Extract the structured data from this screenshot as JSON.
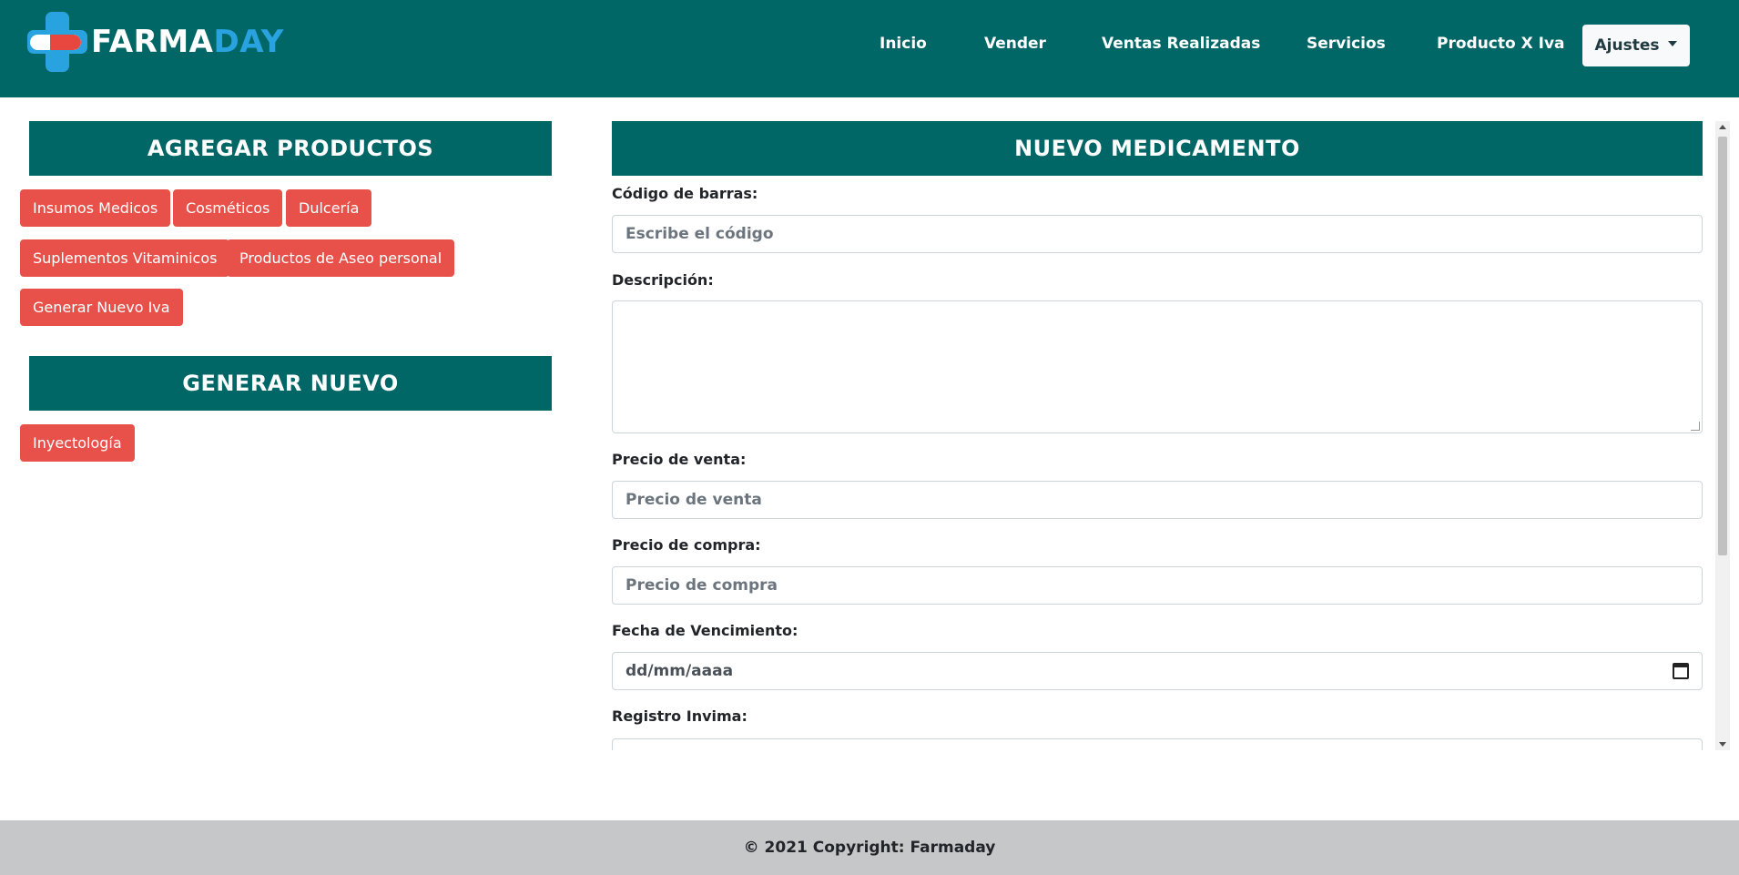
{
  "brand": {
    "name_white": "FARMA",
    "name_blue": "DAY"
  },
  "nav": {
    "items": [
      {
        "label": "Inicio"
      },
      {
        "label": "Vender"
      },
      {
        "label": "Ventas Realizadas"
      },
      {
        "label": "Servicios"
      },
      {
        "label": "Producto X Iva"
      }
    ],
    "settings_label": "Ajustes"
  },
  "left": {
    "add_header": "AGREGAR PRODUCTOS",
    "add_buttons": [
      {
        "label": "Insumos Medicos"
      },
      {
        "label": "Cosméticos"
      },
      {
        "label": "Dulcería"
      },
      {
        "label": "Suplementos Vitaminicos"
      },
      {
        "label": "Productos de Aseo personal"
      },
      {
        "label": "Generar Nuevo Iva"
      }
    ],
    "new_header": "GENERAR NUEVO",
    "new_buttons": [
      {
        "label": "Inyectología"
      }
    ]
  },
  "form": {
    "title": "NUEVO MEDICAMENTO",
    "barcode_label": "Código de barras:",
    "barcode_placeholder": "Escribe el código",
    "description_label": "Descripción:",
    "sale_price_label": "Precio de venta:",
    "sale_price_placeholder": "Precio de venta",
    "purchase_price_label": "Precio de compra:",
    "purchase_price_placeholder": "Precio de compra",
    "expiry_label": "Fecha de Vencimiento:",
    "expiry_value": "dd/mm/aaaa",
    "invima_label": "Registro Invima:"
  },
  "footer": {
    "text": "© 2021 Copyright: Farmaday"
  },
  "colors": {
    "primary": "#006666",
    "accent_blue": "#29a3df",
    "button_red": "#e8514a",
    "footer_bg": "#c6c7c9"
  }
}
